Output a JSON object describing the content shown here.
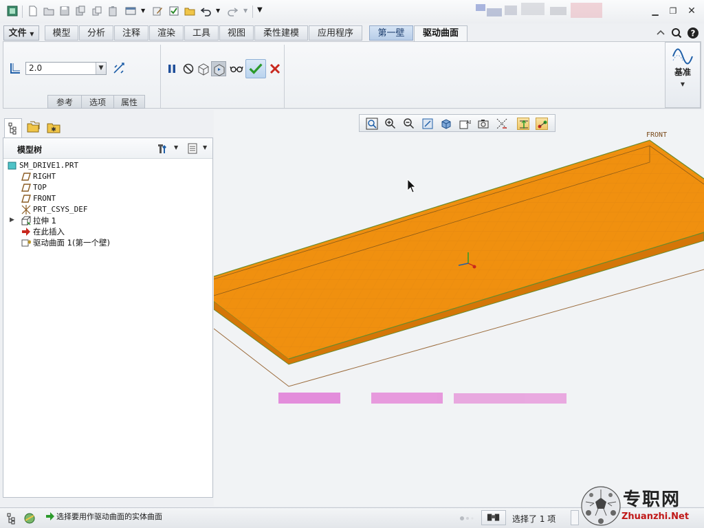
{
  "ribbon_tabs": {
    "file": "文件",
    "items": [
      "模型",
      "分析",
      "注释",
      "渲染",
      "工具",
      "视图",
      "柔性建模",
      "应用程序"
    ],
    "first_wall": "第一壁",
    "active": "驱动曲面"
  },
  "ribbon": {
    "thickness_value": "2.0",
    "panels": [
      "参考",
      "选项",
      "属性"
    ],
    "datum_label": "基准"
  },
  "model_tree": {
    "title": "模型树",
    "items": [
      {
        "label": "SM_DRIVE1.PRT",
        "icon": "part-icon"
      },
      {
        "label": "RIGHT",
        "icon": "datum-plane-icon"
      },
      {
        "label": "TOP",
        "icon": "datum-plane-icon"
      },
      {
        "label": "FRONT",
        "icon": "datum-plane-icon"
      },
      {
        "label": "PRT_CSYS_DEF",
        "icon": "coordinate-system-icon"
      },
      {
        "label": "拉伸 1",
        "icon": "extrude-icon"
      },
      {
        "label": "在此插入",
        "icon": "insert-here-arrow-icon"
      },
      {
        "label": "驱动曲面 1(第一个壁)",
        "icon": "drive-surface-icon"
      }
    ]
  },
  "viewport": {
    "datum_label": "FRONT"
  },
  "status": {
    "message": "选择要用作驱动曲面的实体曲面",
    "selection": "选择了 1 项"
  },
  "watermark": {
    "cn": "专职网",
    "en": "Zhuanzhi.Net"
  },
  "colors": {
    "part_fill": "#f0900f",
    "part_edge": "#6b8a2a",
    "accent_blue": "#1f5fa8",
    "ok_green": "#2b9a2b",
    "cancel_red": "#c8281e"
  }
}
